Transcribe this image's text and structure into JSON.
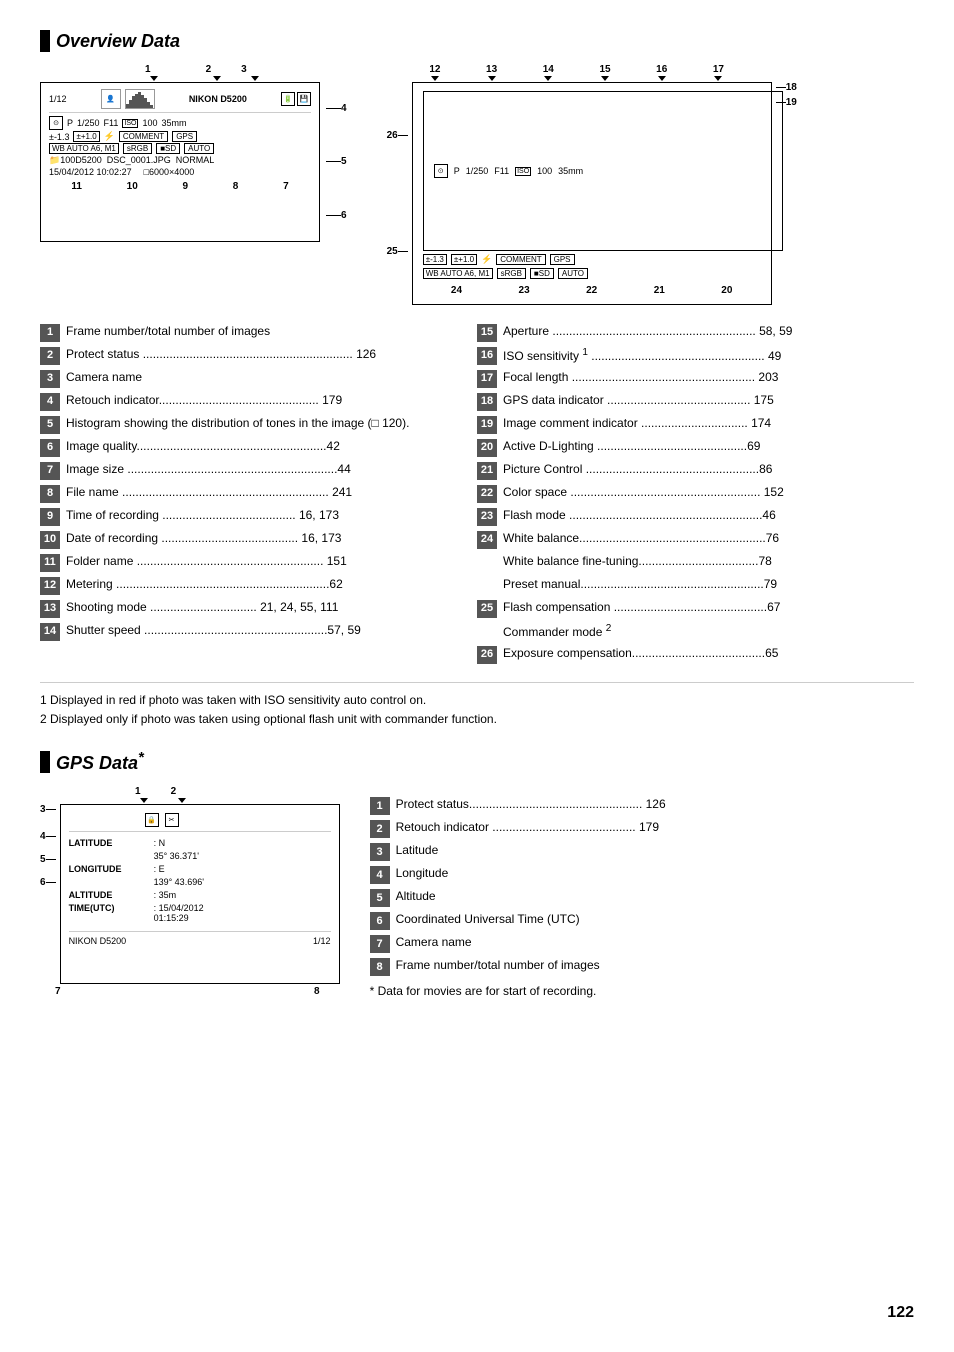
{
  "page": {
    "number": "122"
  },
  "overview_section": {
    "title": "Overview Data",
    "diagram": {
      "top_callouts": [
        "1",
        "2",
        "3"
      ],
      "callout4": "4",
      "callout5": "5",
      "callout6": "6",
      "bottom_callouts": [
        "11",
        "10",
        "9",
        "8",
        "7"
      ],
      "camera_row1": "1/12",
      "camera_model": "NIKON D5200",
      "camera_row2_mode": "P",
      "camera_row2_speed": "1/250",
      "camera_row2_aperture": "F11",
      "camera_row2_iso": "ISO 100",
      "camera_row2_focal": "35mm",
      "camera_row3": "±-1.3  ±+1.0  ⚡",
      "camera_row3_comment": "COMMENT",
      "camera_row3_gps": "GPS",
      "camera_row4_wb": "WB AUTO A6, M1",
      "camera_row4_rgb": "sRGB",
      "camera_row4_sd": "SD",
      "camera_row4_auto": "AUTO",
      "camera_row5_path": "100D5200   DSC_0001.JPG   NORMAL",
      "camera_row6_date": "15/04/2012 10:02:27",
      "camera_row6_size": "6000×4000"
    },
    "right_diagram": {
      "top_callouts": [
        "12",
        "13",
        "14",
        "15",
        "16",
        "17"
      ],
      "right_callouts_18_19": [
        "18",
        "19"
      ],
      "left_callouts_26_25": [
        "26",
        "25"
      ],
      "bottom_callouts": [
        "24",
        "23",
        "22",
        "21",
        "20"
      ],
      "row1_mode": "P",
      "row1_speed": "1/250",
      "row1_aperture": "F11",
      "row1_iso": "ISO 100",
      "row1_focal": "35mm",
      "row2_exp": "±-1.3",
      "row2_flash": "±+1.0",
      "row2_comment": "COMMENT",
      "row2_gps": "GPS",
      "row3_wb": "WB AUTO A6, M1",
      "row3_rgb": "sRGB",
      "row3_sd": "SD",
      "row3_auto": "AUTO"
    },
    "items_left": [
      {
        "num": "1",
        "text": "Frame number/total number of images",
        "page": ""
      },
      {
        "num": "2",
        "text": "Protect status",
        "dots": true,
        "page": "126"
      },
      {
        "num": "3",
        "text": "Camera name",
        "page": ""
      },
      {
        "num": "4",
        "text": "Retouch indicator",
        "dots": true,
        "page": "179"
      },
      {
        "num": "5",
        "text": "Histogram showing the distribution of tones in the image (",
        "book": "120",
        "text2": ").",
        "page": ""
      },
      {
        "num": "6",
        "text": "Image quality",
        "dots": true,
        "page": "42"
      },
      {
        "num": "7",
        "text": "Image size",
        "dots": true,
        "page": "44"
      },
      {
        "num": "8",
        "text": "File name",
        "dots": true,
        "page": "241"
      },
      {
        "num": "9",
        "text": "Time of recording",
        "dots": true,
        "page": "16, 173"
      },
      {
        "num": "10",
        "text": "Date of recording",
        "dots": true,
        "page": "16, 173"
      },
      {
        "num": "11",
        "text": "Folder name",
        "dots": true,
        "page": "151"
      },
      {
        "num": "12",
        "text": "Metering",
        "dots": true,
        "page": "62"
      },
      {
        "num": "13",
        "text": "Shooting mode",
        "dots": true,
        "page": "21, 24, 55, 111"
      },
      {
        "num": "14",
        "text": "Shutter speed",
        "dots": true,
        "page": "57, 59"
      }
    ],
    "items_right": [
      {
        "num": "15",
        "text": "Aperture",
        "dots": true,
        "page": "58, 59"
      },
      {
        "num": "16",
        "text": "ISO sensitivity",
        "sup": "1",
        "dots": true,
        "page": "49"
      },
      {
        "num": "17",
        "text": "Focal length",
        "dots": true,
        "page": "203"
      },
      {
        "num": "18",
        "text": "GPS data indicator",
        "dots": true,
        "page": "175"
      },
      {
        "num": "19",
        "text": "Image comment indicator",
        "dots": true,
        "page": "174"
      },
      {
        "num": "20",
        "text": "Active D-Lighting",
        "dots": true,
        "page": "69"
      },
      {
        "num": "21",
        "text": "Picture Control",
        "dots": true,
        "page": "86"
      },
      {
        "num": "22",
        "text": "Color space",
        "dots": true,
        "page": "152"
      },
      {
        "num": "23",
        "text": "Flash mode",
        "dots": true,
        "page": "46"
      },
      {
        "num": "24",
        "text": "White balance",
        "dots": true,
        "page": "76"
      },
      {
        "num": "",
        "text": "White balance fine-tuning",
        "dots": true,
        "page": "78"
      },
      {
        "num": "",
        "text": "Preset manual",
        "dots": true,
        "page": "79"
      },
      {
        "num": "25",
        "text": "Flash compensation",
        "dots": true,
        "page": "67"
      },
      {
        "num": "",
        "text": "Commander mode",
        "sup": "2",
        "page": ""
      },
      {
        "num": "26",
        "text": "Exposure compensation",
        "dots": true,
        "page": "65"
      }
    ],
    "footnotes": [
      "1  Displayed in red if photo was taken with ISO sensitivity auto control on.",
      "2  Displayed only if photo was taken using optional flash unit with commander function."
    ]
  },
  "gps_section": {
    "title": "GPS Data",
    "title_sup": "*",
    "diagram": {
      "top_callouts": [
        "1",
        "2"
      ],
      "left_callouts": [
        "3",
        "4",
        "5",
        "6"
      ],
      "bottom_left": "7",
      "bottom_right": "1/12",
      "bottom_right_num": "8",
      "latitude_label": "LATITUDE",
      "latitude_dir": "N",
      "latitude_value": "35° 36.371'",
      "longitude_label": "LONGITUDE",
      "longitude_dir": "E",
      "longitude_value": "139° 43.696'",
      "altitude_label": "ALTITUDE",
      "altitude_value": "35m",
      "time_label": "TIME(UTC)",
      "time_value": "15/04/2012\n01:15:29",
      "camera_name": "NIKON D5200",
      "frame_info": "1/12"
    },
    "items": [
      {
        "num": "1",
        "text": "Protect status",
        "dots": true,
        "page": "126"
      },
      {
        "num": "2",
        "text": "Retouch indicator",
        "dots": true,
        "page": "179"
      },
      {
        "num": "3",
        "text": "Latitude",
        "page": ""
      },
      {
        "num": "4",
        "text": "Longitude",
        "page": ""
      },
      {
        "num": "5",
        "text": "Altitude",
        "page": ""
      },
      {
        "num": "6",
        "text": "Coordinated Universal Time (UTC)",
        "page": ""
      },
      {
        "num": "7",
        "text": "Camera name",
        "page": ""
      },
      {
        "num": "8",
        "text": "Frame number/total number of images",
        "page": ""
      }
    ],
    "footnote": "* Data for movies are for start of recording."
  }
}
